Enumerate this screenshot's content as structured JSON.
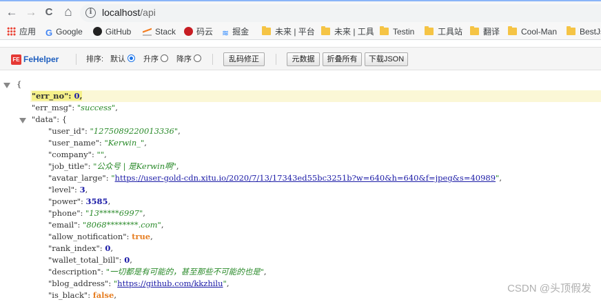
{
  "browser": {
    "back_icon": "←",
    "forward_icon": "→",
    "reload_icon": "C",
    "home_icon": "⌂",
    "url_host": "localhost",
    "url_path": "/api"
  },
  "bookmarks": {
    "apps": "应用",
    "google": "Google",
    "github": "GitHub",
    "stack": "Stack",
    "mayun": "码云",
    "juejin": "掘金",
    "weilai_platform": "未来 | 平台",
    "weilai_tools": "未来 | 工具",
    "testin": "Testin",
    "gongjuzhan": "工具站",
    "fanyi": "翻译",
    "coolman": "Cool-Man",
    "bestjs": "BestJs"
  },
  "fehelper": {
    "logo": "FeHelper",
    "logo_badge": "FE",
    "sort_label": "排序:",
    "sort_default": "默认",
    "sort_asc": "升序",
    "sort_desc": "降序",
    "fix_encoding": "乱码修正",
    "raw_data": "元数据",
    "collapse_all": "折叠所有",
    "download_json": "下载JSON"
  },
  "json": {
    "open_brace": "{",
    "err_no_key": "\"err_no\"",
    "err_no_val": "0",
    "err_msg_key": "\"err_msg\"",
    "err_msg_val": "\"success\"",
    "data_key": "\"data\"",
    "user_id_key": "\"user_id\"",
    "user_id_val": "\"1275089220013336\"",
    "user_name_key": "\"user_name\"",
    "user_name_val": "\"Kerwin_\"",
    "company_key": "\"company\"",
    "company_val": "\"\"",
    "job_title_key": "\"job_title\"",
    "job_title_val": "\"公众号 | 是Kerwin啊\"",
    "avatar_large_key": "\"avatar_large\"",
    "avatar_large_val": "https://user-gold-cdn.xitu.io/2020/7/13/17343ed55bc3251b?w=640&h=640&f=jpeg&s=40989",
    "level_key": "\"level\"",
    "level_val": "3",
    "power_key": "\"power\"",
    "power_val": "3585",
    "phone_key": "\"phone\"",
    "phone_val": "\"13*****6997\"",
    "email_key": "\"email\"",
    "email_val": "\"8068********.com\"",
    "allow_notification_key": "\"allow_notification\"",
    "allow_notification_val": "true",
    "rank_index_key": "\"rank_index\"",
    "rank_index_val": "0",
    "wallet_total_bill_key": "\"wallet_total_bill\"",
    "wallet_total_bill_val": "0",
    "description_key": "\"description\"",
    "description_val": "\"一切都是有可能的，甚至那些不可能的也是\"",
    "blog_address_key": "\"blog_address\"",
    "blog_address_val": "https://github.com/kkzhilu",
    "is_black_key": "\"is_black\"",
    "is_black_val": "false"
  },
  "watermark": "CSDN @头顶假发"
}
